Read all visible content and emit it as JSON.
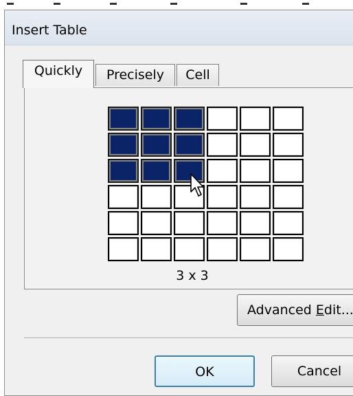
{
  "window": {
    "title": "Insert Table"
  },
  "tabs": [
    {
      "label": "Quickly"
    },
    {
      "label": "Precisely"
    },
    {
      "label": "Cell"
    }
  ],
  "grid": {
    "rows": 6,
    "cols": 6,
    "selected_rows": 3,
    "selected_cols": 3,
    "size_label": "3 x 3",
    "selected_color": "#0b2468"
  },
  "buttons": {
    "advanced_pre": "Advanced ",
    "advanced_accel": "E",
    "advanced_post": "dit...",
    "ok": "OK",
    "cancel": "Cancel"
  }
}
